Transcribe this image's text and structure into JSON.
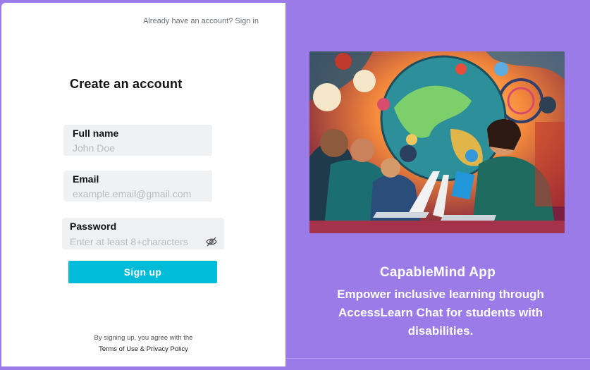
{
  "auth": {
    "signin_prompt": "Already have an account? Sign in",
    "title": "Create an account"
  },
  "form": {
    "full_name": {
      "label": "Full name",
      "placeholder": "John Doe"
    },
    "email": {
      "label": "Email",
      "placeholder": "example.email@gmail.com"
    },
    "password": {
      "label": "Password",
      "placeholder": "Enter at least 8+characters"
    },
    "submit_label": "Sign up"
  },
  "terms": {
    "line1": "By signing up, you agree with the",
    "line2": "Terms of Use & Privacy Policy"
  },
  "promo": {
    "app_name": "CapableMind App",
    "tagline": "Empower inclusive learning through AccessLearn Chat for students with disabilities.",
    "image_icon": "illustration-students-globe-laptops"
  },
  "colors": {
    "background": "#9b7be8",
    "button": "#00bcd9",
    "field": "#f0f1f3"
  },
  "icons": {
    "password_toggle": "eye-slash-icon"
  }
}
